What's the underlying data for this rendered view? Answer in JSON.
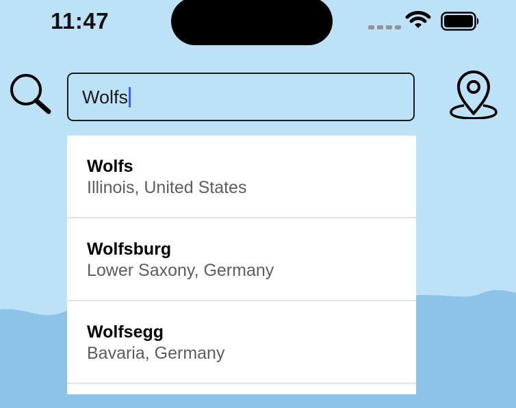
{
  "status_bar": {
    "time": "11:47"
  },
  "search": {
    "value": "Wolfs"
  },
  "results": [
    {
      "name": "Wolfs",
      "region": "Illinois, United States"
    },
    {
      "name": "Wolfsburg",
      "region": "Lower Saxony, Germany"
    },
    {
      "name": "Wolfsegg",
      "region": "Bavaria, Germany"
    }
  ],
  "icons": {
    "search": "magnifying-glass",
    "location": "map-pin",
    "wifi": "wifi",
    "battery": "battery-full",
    "cellular": "cellular-signal"
  },
  "colors": {
    "sky": "#bde2f7",
    "hills": "#8dc3e6",
    "caret": "#3d64e0",
    "card": "#ffffff",
    "secondary_text": "#5d5d5f"
  }
}
